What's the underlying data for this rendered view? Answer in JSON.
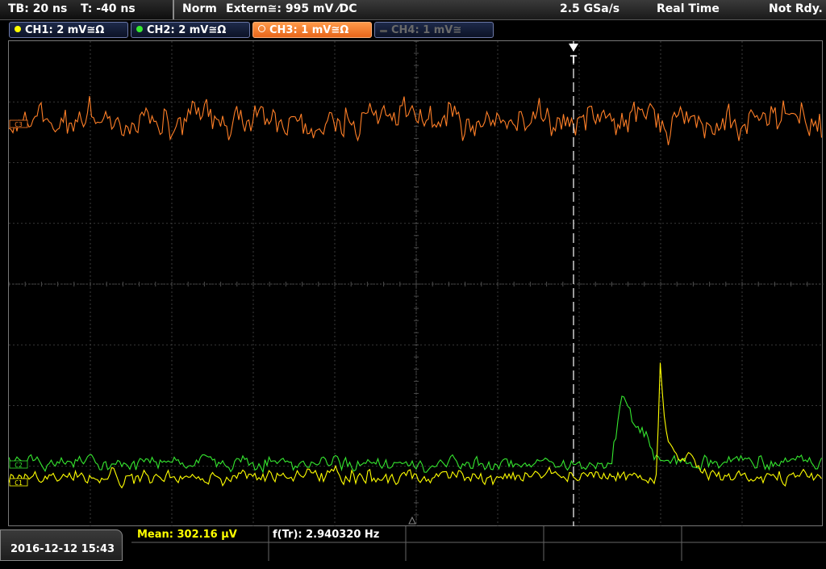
{
  "top_bar": {
    "timebase": "TB: 20 ns",
    "trigger_offset": "T: -40 ns",
    "mode": "Norm",
    "trigger_source": "Extern≅: 995 mV ⁄DC",
    "sample_rate": "2.5 GSa/s",
    "acq_mode": "Real Time",
    "status": "Not Rdy."
  },
  "channels": [
    {
      "label": "CH1: 2 mV≅Ω",
      "color": "#ffff00",
      "active": false
    },
    {
      "label": "CH2: 2 mV≅Ω",
      "color": "#35e82f",
      "active": false
    },
    {
      "label": "CH3: 1 mV≅Ω",
      "color": "#ff7f27",
      "active": true
    },
    {
      "label": "CH4: 1 mV≅",
      "color": "#6a6a6a",
      "active": false
    }
  ],
  "markers": {
    "ch3": "C3",
    "ch2": "C2",
    "ch1": "C1",
    "trigger": "T"
  },
  "measurements": {
    "mean": "Mean: 302.16 µV",
    "freq": "f(Tr): 2.940320 Hz"
  },
  "datetime": "2016-12-12 15:43",
  "colors": {
    "ch1": "#ffff00",
    "ch2": "#35e82f",
    "ch3": "#ff7f27",
    "grid": "#4a4a4a"
  }
}
